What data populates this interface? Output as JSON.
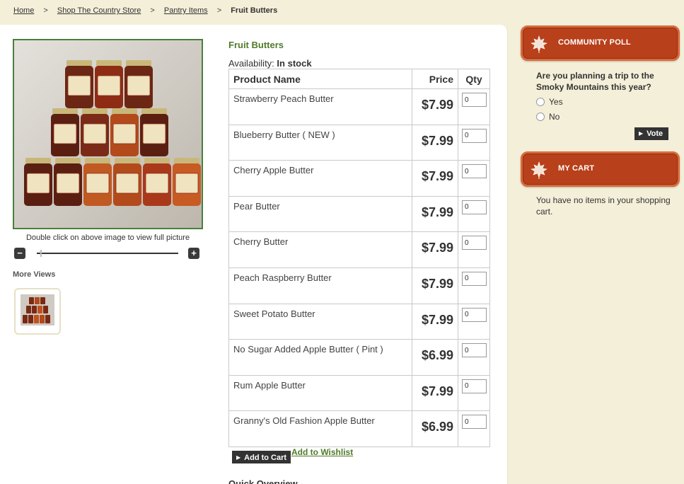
{
  "breadcrumb": {
    "items": [
      "Home",
      "Shop The Country Store",
      "Pantry Items"
    ],
    "separator": ">",
    "current": "Fruit Butters"
  },
  "product": {
    "title": "Fruit Butters",
    "availability_label": "Availability:",
    "availability_value": "In stock",
    "image_caption": "Double click on above image to view full picture",
    "more_views_label": "More Views",
    "zoom_out_symbol": "−",
    "zoom_in_symbol": "+"
  },
  "table": {
    "headers": {
      "name": "Product Name",
      "price": "Price",
      "qty": "Qty"
    },
    "rows": [
      {
        "name": "Strawberry Peach Butter",
        "price": "$7.99",
        "qty": "0"
      },
      {
        "name": "Blueberry Butter ( NEW )",
        "price": "$7.99",
        "qty": "0"
      },
      {
        "name": "Cherry Apple Butter",
        "price": "$7.99",
        "qty": "0"
      },
      {
        "name": "Pear Butter",
        "price": "$7.99",
        "qty": "0"
      },
      {
        "name": "Cherry Butter",
        "price": "$7.99",
        "qty": "0"
      },
      {
        "name": "Peach Raspberry Butter",
        "price": "$7.99",
        "qty": "0"
      },
      {
        "name": "Sweet Potato Butter",
        "price": "$7.99",
        "qty": "0"
      },
      {
        "name": "No Sugar Added Apple Butter ( Pint )",
        "price": "$6.99",
        "qty": "0"
      },
      {
        "name": "Rum Apple Butter",
        "price": "$7.99",
        "qty": "0"
      },
      {
        "name": "Granny's Old Fashion Apple Butter",
        "price": "$6.99",
        "qty": "0"
      }
    ]
  },
  "actions": {
    "add_to_cart": "Add to Cart",
    "add_to_wishlist": "Add to Wishlist",
    "quick_overview": "Quick Overview"
  },
  "sidebar": {
    "poll": {
      "title": "COMMUNITY POLL",
      "question": "Are you planning a trip to the Smoky Mountains this year?",
      "options": [
        "Yes",
        "No"
      ],
      "vote_label": "Vote"
    },
    "cart": {
      "title": "MY CART",
      "empty_message": "You have no items in your shopping cart."
    }
  },
  "colors": {
    "background": "#f4efd9",
    "accent_green": "#4f7a2a",
    "sidebar_header": "#b8401b",
    "button_dark": "#333333"
  }
}
